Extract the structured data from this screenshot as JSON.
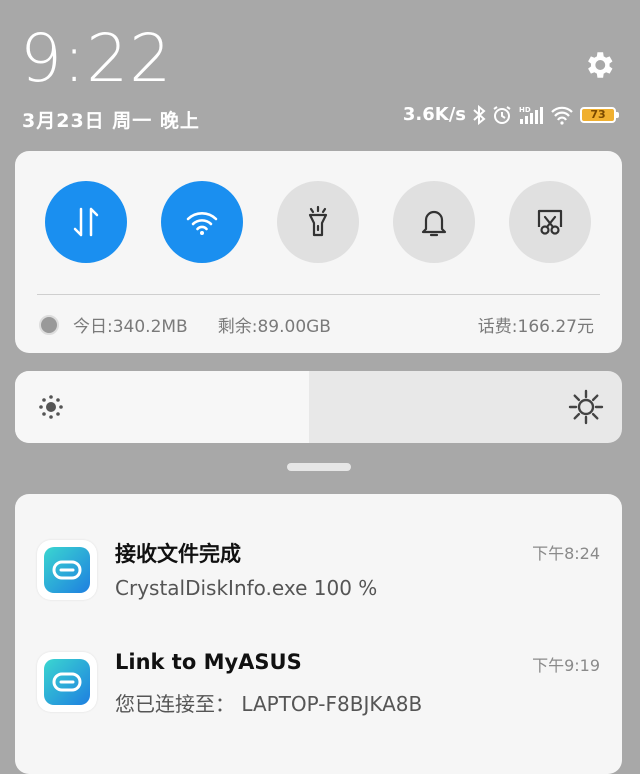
{
  "header": {
    "time": "9:22",
    "date": "3月23日 周一 晚上",
    "net_speed": "3.6K/s",
    "battery": "73"
  },
  "usage": {
    "today": "今日:340.2MB",
    "remaining": "剩余:89.00GB",
    "fee": "话费:166.27元"
  },
  "toggles": [
    {
      "name": "mobile-data",
      "state": "on"
    },
    {
      "name": "wifi",
      "state": "on"
    },
    {
      "name": "flashlight",
      "state": "off"
    },
    {
      "name": "notification-bell",
      "state": "off"
    },
    {
      "name": "screenshot",
      "state": "off"
    }
  ],
  "brightness": {
    "level": 0.48
  },
  "notifications": [
    {
      "title": "接收文件完成",
      "body": "CrystalDiskInfo.exe 100 %",
      "time": "下午8:24"
    },
    {
      "title": "Link to MyASUS",
      "body": "您已连接至： LAPTOP-F8BJKA8B",
      "time": "下午9:19"
    }
  ],
  "colors": {
    "accent": "#1a8ff0",
    "battery": "#f0b030",
    "app_icon": "#1ea3e8"
  }
}
